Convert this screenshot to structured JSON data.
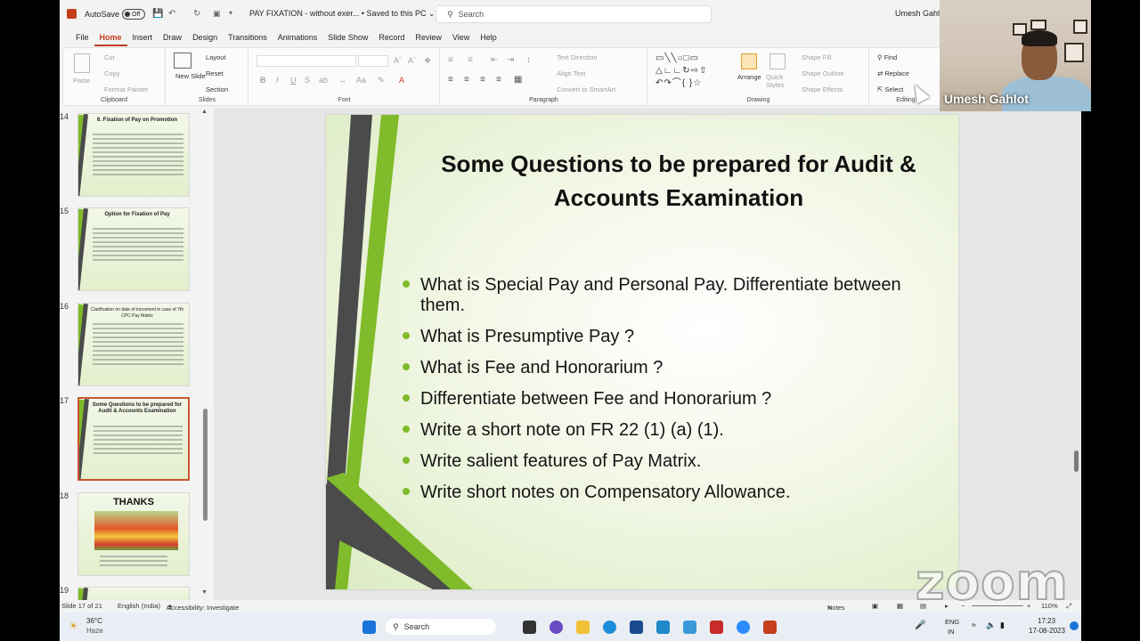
{
  "titlebar": {
    "autosave_label": "AutoSave",
    "autosave_state": "Off",
    "doc_title": "PAY FIXATION - without exer... • Saved to this PC ⌄",
    "search_placeholder": "Search",
    "user_name": "Umesh Gahlot"
  },
  "menu": {
    "tabs": [
      "File",
      "Home",
      "Insert",
      "Draw",
      "Design",
      "Transitions",
      "Animations",
      "Slide Show",
      "Record",
      "Review",
      "View",
      "Help"
    ],
    "active": "Home"
  },
  "ribbon": {
    "clipboard": {
      "label": "Clipboard",
      "paste": "Paste",
      "cut": "Cut",
      "copy": "Copy",
      "format_painter": "Format Painter"
    },
    "slides": {
      "label": "Slides",
      "new_slide": "New Slide",
      "layout": "Layout",
      "reset": "Reset",
      "section": "Section"
    },
    "font": {
      "label": "Font",
      "bold": "B",
      "italic": "I",
      "underline": "U",
      "strike": "S",
      "shadow": "ab"
    },
    "paragraph": {
      "label": "Paragraph",
      "text_direction": "Text Direction",
      "align_text": "Align Text",
      "convert_smartart": "Convert to SmartArt"
    },
    "drawing": {
      "label": "Drawing",
      "arrange": "Arrange",
      "quick_styles": "Quick Styles",
      "shape_fill": "Shape Fill",
      "shape_outline": "Shape Outline",
      "shape_effects": "Shape Effects"
    },
    "editing": {
      "label": "Editing",
      "find": "Find",
      "replace": "Replace",
      "select": "Select"
    }
  },
  "thumbnails": [
    {
      "num": "14",
      "title": "6. Fixation of Pay on Promotion"
    },
    {
      "num": "15",
      "title": "Option for Fixation of Pay"
    },
    {
      "num": "16",
      "title": "Clarification on date of increment in case of 7th CPC Pay Matrix"
    },
    {
      "num": "17",
      "title": "Some Questions to be prepared for Audit & Accounts Examination"
    },
    {
      "num": "18",
      "title": "THANKS"
    },
    {
      "num": "19",
      "title": ""
    }
  ],
  "slide": {
    "title": "Some Questions to be prepared for Audit & Accounts Examination",
    "bullets": [
      "What is Special Pay and Personal Pay. Differentiate between them.",
      "What is Presumptive Pay ?",
      "What is Fee and Honorarium ?",
      "Differentiate between Fee and Honorarium ?",
      "Write a short note on FR 22 (1) (a) (1).",
      "Write salient features of Pay Matrix.",
      "Write short notes on Compensatory Allowance."
    ]
  },
  "statusbar": {
    "slide_count": "Slide 17 of 21",
    "language": "English (India)",
    "accessibility": "Accessibility: Investigate",
    "notes": "Notes",
    "zoom": "110%"
  },
  "taskbar": {
    "weather_temp": "36°C",
    "weather_desc": "Haze",
    "search": "Search",
    "lang": "ENG",
    "region": "IN",
    "time": "17:23",
    "date": "17-08-2023"
  },
  "webcam": {
    "name": "Umesh Gahlot"
  },
  "watermark": "zoom",
  "colors": {
    "accent": "#c43e1c",
    "slide_green": "#7fbb2a",
    "slide_dark": "#4b4b4b"
  }
}
